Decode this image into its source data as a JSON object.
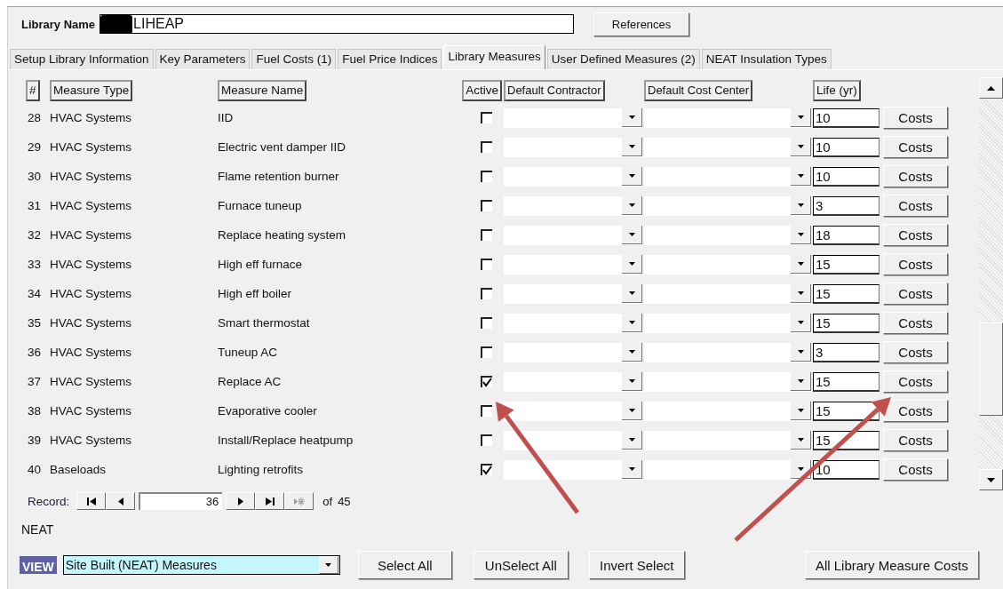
{
  "library_name": {
    "label": "Library Name",
    "value": "LIHEAP",
    "redacted_prefix": true
  },
  "references_button": "References",
  "tabs": [
    {
      "label": "Setup Library Information",
      "selected": false
    },
    {
      "label": "Key Parameters",
      "selected": false
    },
    {
      "label": "Fuel Costs (1)",
      "selected": false
    },
    {
      "label": "Fuel Price Indices",
      "selected": false
    },
    {
      "label": "Library Measures",
      "selected": true
    },
    {
      "label": "User Defined Measures (2)",
      "selected": false
    },
    {
      "label": "NEAT Insulation Types",
      "selected": false
    }
  ],
  "table": {
    "columns": [
      "#",
      "Measure Type",
      "Measure Name",
      "Active",
      "Default Contractor",
      "Default Cost Center",
      "Life (yr)"
    ],
    "rows": [
      {
        "num": "28",
        "type": "HVAC Systems",
        "name": "IID",
        "active": false,
        "life": "10",
        "button": "Costs"
      },
      {
        "num": "29",
        "type": "HVAC Systems",
        "name": "Electric vent damper IID",
        "active": false,
        "life": "10",
        "button": "Costs"
      },
      {
        "num": "30",
        "type": "HVAC Systems",
        "name": "Flame retention burner",
        "active": false,
        "life": "10",
        "button": "Costs"
      },
      {
        "num": "31",
        "type": "HVAC Systems",
        "name": "Furnace tuneup",
        "active": false,
        "life": "3",
        "button": "Costs"
      },
      {
        "num": "32",
        "type": "HVAC Systems",
        "name": "Replace heating system",
        "active": false,
        "life": "18",
        "button": "Costs"
      },
      {
        "num": "33",
        "type": "HVAC Systems",
        "name": "High eff furnace",
        "active": false,
        "life": "15",
        "button": "Costs"
      },
      {
        "num": "34",
        "type": "HVAC Systems",
        "name": "High eff boiler",
        "active": false,
        "life": "15",
        "button": "Costs"
      },
      {
        "num": "35",
        "type": "HVAC Systems",
        "name": "Smart thermostat",
        "active": false,
        "life": "15",
        "button": "Costs"
      },
      {
        "num": "36",
        "type": "HVAC Systems",
        "name": "Tuneup AC",
        "active": false,
        "life": "3",
        "button": "Costs"
      },
      {
        "num": "37",
        "type": "HVAC Systems",
        "name": "Replace AC",
        "active": true,
        "life": "15",
        "button": "Costs"
      },
      {
        "num": "38",
        "type": "HVAC Systems",
        "name": "Evaporative cooler",
        "active": false,
        "life": "15",
        "button": "Costs"
      },
      {
        "num": "39",
        "type": "HVAC Systems",
        "name": "Install/Replace heatpump",
        "active": false,
        "life": "15",
        "button": "Costs"
      },
      {
        "num": "40",
        "type": "Baseloads",
        "name": "Lighting retrofits",
        "active": true,
        "life": "10",
        "button": "Costs"
      }
    ]
  },
  "record_nav": {
    "label": "Record:",
    "current": "36",
    "of_label": "of",
    "total": "45"
  },
  "footer_label": "NEAT",
  "view": {
    "label": "VIEW",
    "value": "Site Built (NEAT) Measures"
  },
  "buttons": [
    "Select All",
    "UnSelect All",
    "Invert Select",
    "All Library Measure Costs"
  ],
  "annotations": [
    {
      "kind": "arrow"
    },
    {
      "kind": "arrow"
    }
  ]
}
